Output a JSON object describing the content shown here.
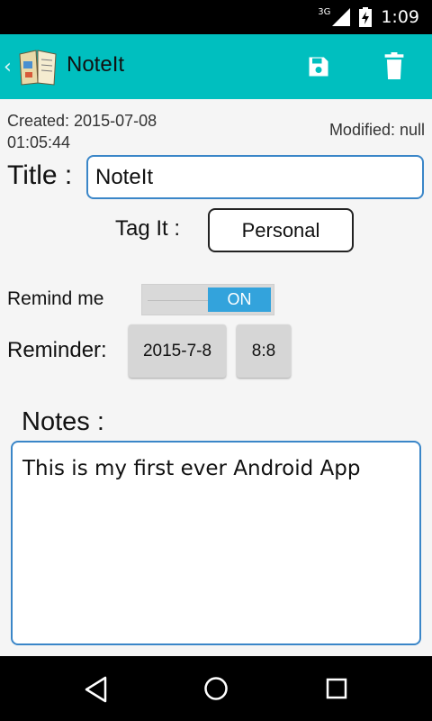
{
  "status_bar": {
    "network": "3G",
    "time": "1:09",
    "icons": [
      "signal-icon",
      "battery-charging-icon"
    ]
  },
  "action_bar": {
    "title": "NoteIt",
    "icons": [
      "back-chevron-icon",
      "notebook-app-icon",
      "save-icon",
      "delete-icon"
    ],
    "color": "#00bfbf"
  },
  "meta": {
    "created": "Created: 2015-07-08 01:05:44",
    "modified": "Modified: null"
  },
  "form": {
    "title_label": "Title :",
    "title_value": "NoteIt",
    "tag_label": "Tag It :",
    "tag_value": "Personal",
    "remind_label": "Remind me",
    "remind_state": "ON",
    "reminder_label": "Reminder:",
    "reminder_date": "2015-7-8",
    "reminder_time": "8:8",
    "notes_label": "Notes :",
    "notes_value": "This is my first ever Android App"
  },
  "colors": {
    "accent": "#33a3dc",
    "input_border": "#3a86c8"
  },
  "nav_bar": {
    "icons": [
      "back-triangle-icon",
      "home-circle-icon",
      "recents-square-icon"
    ]
  }
}
